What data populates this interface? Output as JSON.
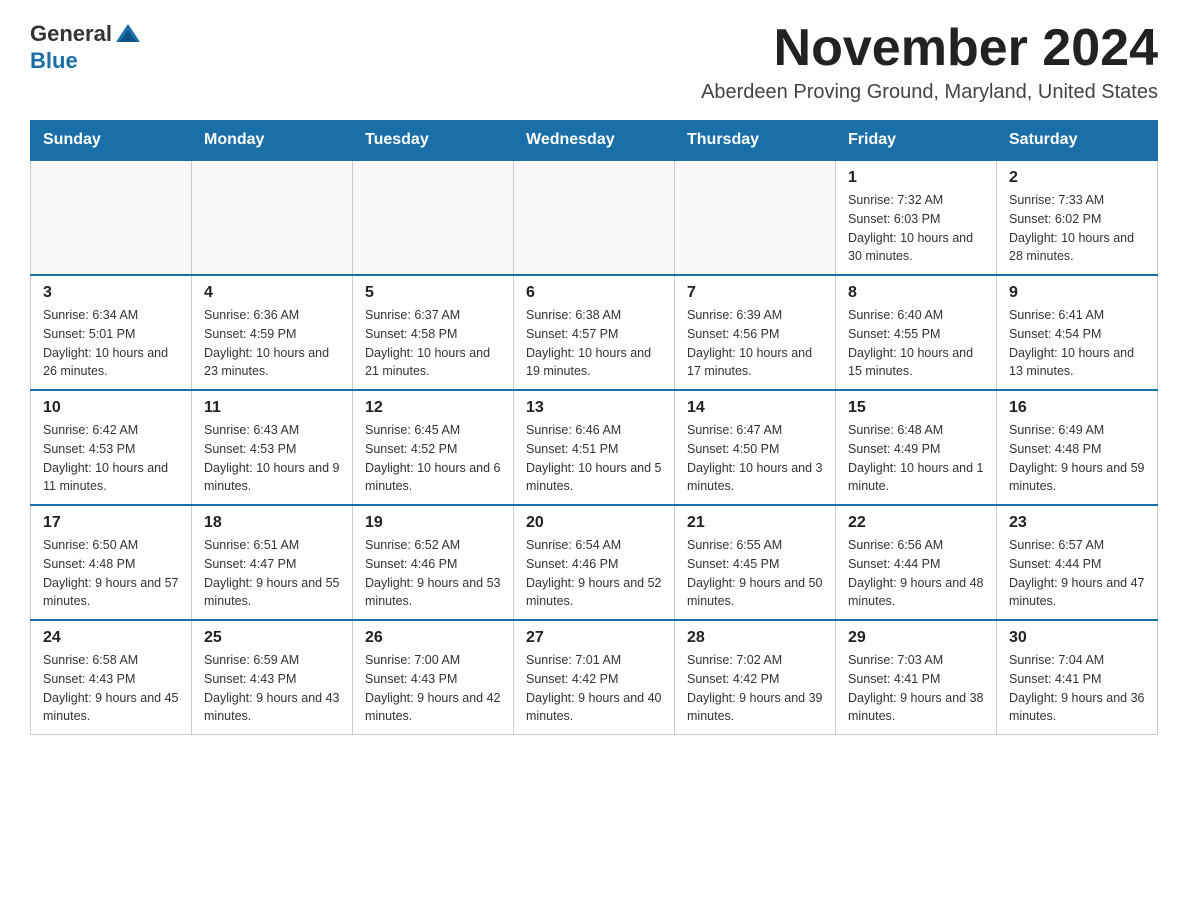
{
  "logo": {
    "general": "General",
    "blue": "Blue"
  },
  "title": "November 2024",
  "subtitle": "Aberdeen Proving Ground, Maryland, United States",
  "weekdays": [
    "Sunday",
    "Monday",
    "Tuesday",
    "Wednesday",
    "Thursday",
    "Friday",
    "Saturday"
  ],
  "weeks": [
    [
      {
        "day": "",
        "info": ""
      },
      {
        "day": "",
        "info": ""
      },
      {
        "day": "",
        "info": ""
      },
      {
        "day": "",
        "info": ""
      },
      {
        "day": "",
        "info": ""
      },
      {
        "day": "1",
        "info": "Sunrise: 7:32 AM\nSunset: 6:03 PM\nDaylight: 10 hours and 30 minutes."
      },
      {
        "day": "2",
        "info": "Sunrise: 7:33 AM\nSunset: 6:02 PM\nDaylight: 10 hours and 28 minutes."
      }
    ],
    [
      {
        "day": "3",
        "info": "Sunrise: 6:34 AM\nSunset: 5:01 PM\nDaylight: 10 hours and 26 minutes."
      },
      {
        "day": "4",
        "info": "Sunrise: 6:36 AM\nSunset: 4:59 PM\nDaylight: 10 hours and 23 minutes."
      },
      {
        "day": "5",
        "info": "Sunrise: 6:37 AM\nSunset: 4:58 PM\nDaylight: 10 hours and 21 minutes."
      },
      {
        "day": "6",
        "info": "Sunrise: 6:38 AM\nSunset: 4:57 PM\nDaylight: 10 hours and 19 minutes."
      },
      {
        "day": "7",
        "info": "Sunrise: 6:39 AM\nSunset: 4:56 PM\nDaylight: 10 hours and 17 minutes."
      },
      {
        "day": "8",
        "info": "Sunrise: 6:40 AM\nSunset: 4:55 PM\nDaylight: 10 hours and 15 minutes."
      },
      {
        "day": "9",
        "info": "Sunrise: 6:41 AM\nSunset: 4:54 PM\nDaylight: 10 hours and 13 minutes."
      }
    ],
    [
      {
        "day": "10",
        "info": "Sunrise: 6:42 AM\nSunset: 4:53 PM\nDaylight: 10 hours and 11 minutes."
      },
      {
        "day": "11",
        "info": "Sunrise: 6:43 AM\nSunset: 4:53 PM\nDaylight: 10 hours and 9 minutes."
      },
      {
        "day": "12",
        "info": "Sunrise: 6:45 AM\nSunset: 4:52 PM\nDaylight: 10 hours and 6 minutes."
      },
      {
        "day": "13",
        "info": "Sunrise: 6:46 AM\nSunset: 4:51 PM\nDaylight: 10 hours and 5 minutes."
      },
      {
        "day": "14",
        "info": "Sunrise: 6:47 AM\nSunset: 4:50 PM\nDaylight: 10 hours and 3 minutes."
      },
      {
        "day": "15",
        "info": "Sunrise: 6:48 AM\nSunset: 4:49 PM\nDaylight: 10 hours and 1 minute."
      },
      {
        "day": "16",
        "info": "Sunrise: 6:49 AM\nSunset: 4:48 PM\nDaylight: 9 hours and 59 minutes."
      }
    ],
    [
      {
        "day": "17",
        "info": "Sunrise: 6:50 AM\nSunset: 4:48 PM\nDaylight: 9 hours and 57 minutes."
      },
      {
        "day": "18",
        "info": "Sunrise: 6:51 AM\nSunset: 4:47 PM\nDaylight: 9 hours and 55 minutes."
      },
      {
        "day": "19",
        "info": "Sunrise: 6:52 AM\nSunset: 4:46 PM\nDaylight: 9 hours and 53 minutes."
      },
      {
        "day": "20",
        "info": "Sunrise: 6:54 AM\nSunset: 4:46 PM\nDaylight: 9 hours and 52 minutes."
      },
      {
        "day": "21",
        "info": "Sunrise: 6:55 AM\nSunset: 4:45 PM\nDaylight: 9 hours and 50 minutes."
      },
      {
        "day": "22",
        "info": "Sunrise: 6:56 AM\nSunset: 4:44 PM\nDaylight: 9 hours and 48 minutes."
      },
      {
        "day": "23",
        "info": "Sunrise: 6:57 AM\nSunset: 4:44 PM\nDaylight: 9 hours and 47 minutes."
      }
    ],
    [
      {
        "day": "24",
        "info": "Sunrise: 6:58 AM\nSunset: 4:43 PM\nDaylight: 9 hours and 45 minutes."
      },
      {
        "day": "25",
        "info": "Sunrise: 6:59 AM\nSunset: 4:43 PM\nDaylight: 9 hours and 43 minutes."
      },
      {
        "day": "26",
        "info": "Sunrise: 7:00 AM\nSunset: 4:43 PM\nDaylight: 9 hours and 42 minutes."
      },
      {
        "day": "27",
        "info": "Sunrise: 7:01 AM\nSunset: 4:42 PM\nDaylight: 9 hours and 40 minutes."
      },
      {
        "day": "28",
        "info": "Sunrise: 7:02 AM\nSunset: 4:42 PM\nDaylight: 9 hours and 39 minutes."
      },
      {
        "day": "29",
        "info": "Sunrise: 7:03 AM\nSunset: 4:41 PM\nDaylight: 9 hours and 38 minutes."
      },
      {
        "day": "30",
        "info": "Sunrise: 7:04 AM\nSunset: 4:41 PM\nDaylight: 9 hours and 36 minutes."
      }
    ]
  ]
}
